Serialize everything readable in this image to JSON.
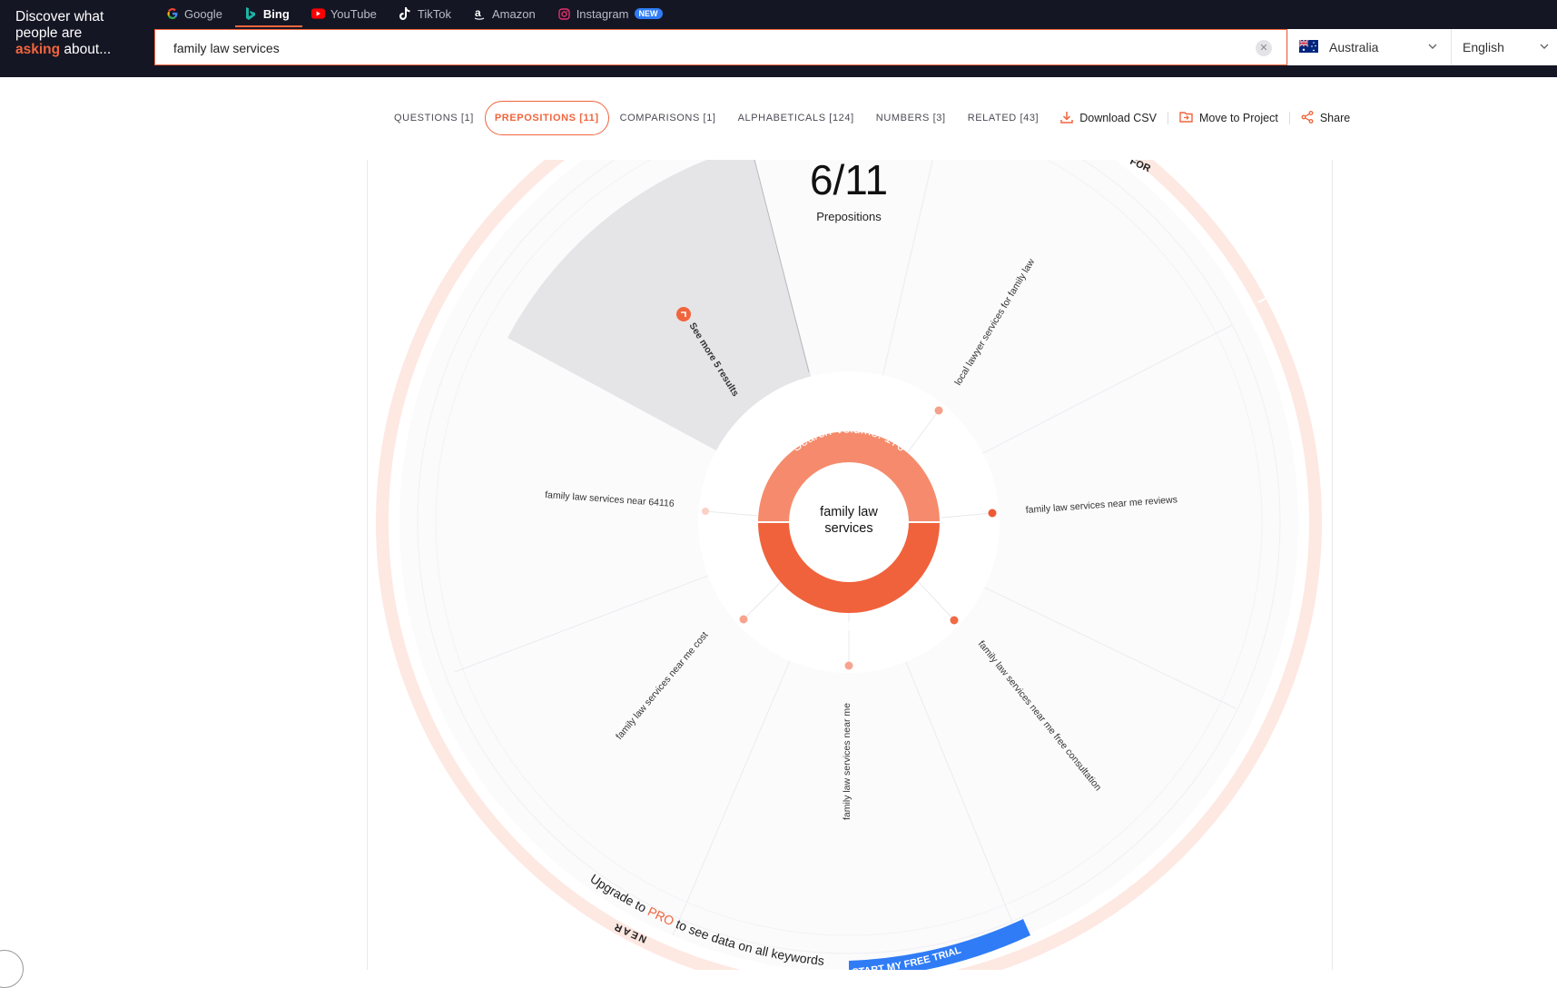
{
  "brand": {
    "line1": "Discover what",
    "line2": "people are",
    "highlight": "asking",
    "line3_rest": " about..."
  },
  "engines": [
    {
      "label": "Google",
      "icon": "google-icon"
    },
    {
      "label": "Bing",
      "icon": "bing-icon",
      "active": true
    },
    {
      "label": "YouTube",
      "icon": "youtube-icon"
    },
    {
      "label": "TikTok",
      "icon": "tiktok-icon"
    },
    {
      "label": "Amazon",
      "icon": "amazon-icon"
    },
    {
      "label": "Instagram",
      "icon": "instagram-icon",
      "badge": "NEW"
    }
  ],
  "search": {
    "value": "family law services",
    "clear_icon": "close-icon"
  },
  "country": {
    "label": "Australia",
    "icon": "australia-flag-icon"
  },
  "language": {
    "label": "English"
  },
  "tabs": [
    {
      "label": "QUESTIONS [1]"
    },
    {
      "label": "PREPOSITIONS [11]",
      "active": true
    },
    {
      "label": "COMPARISONS [1]"
    },
    {
      "label": "ALPHABETICALS [124]"
    },
    {
      "label": "NUMBERS [3]"
    },
    {
      "label": "RELATED [43]"
    }
  ],
  "actions": {
    "download": "Download CSV",
    "move": "Move to Project",
    "share": "Share"
  },
  "wheel": {
    "counter": "6/11",
    "counter_label": "Prepositions",
    "center_text_line1": "family law",
    "center_text_line2": "services",
    "search_volume": "Search Volume: 170",
    "cpc": "Cost Per Click: $15.76",
    "see_more": "See more 5 results",
    "keywords": [
      "local lawyer services for family law",
      "family law services near me reviews",
      "family law services near me free consultation",
      "family law services near me",
      "family law services near me cost",
      "family law services near 64116"
    ],
    "group_label_bottom": "NEAR",
    "group_label_top": "FOR",
    "upgrade_prefix": "Upgrade to ",
    "upgrade_pro": "PRO",
    "upgrade_suffix": " to see data on all keywords",
    "cta": "START MY FREE TRIAL"
  },
  "colors": {
    "accent": "#f1653d",
    "dark": "#151624",
    "cta": "#2f7cf6",
    "ring": "#fde8e2"
  }
}
